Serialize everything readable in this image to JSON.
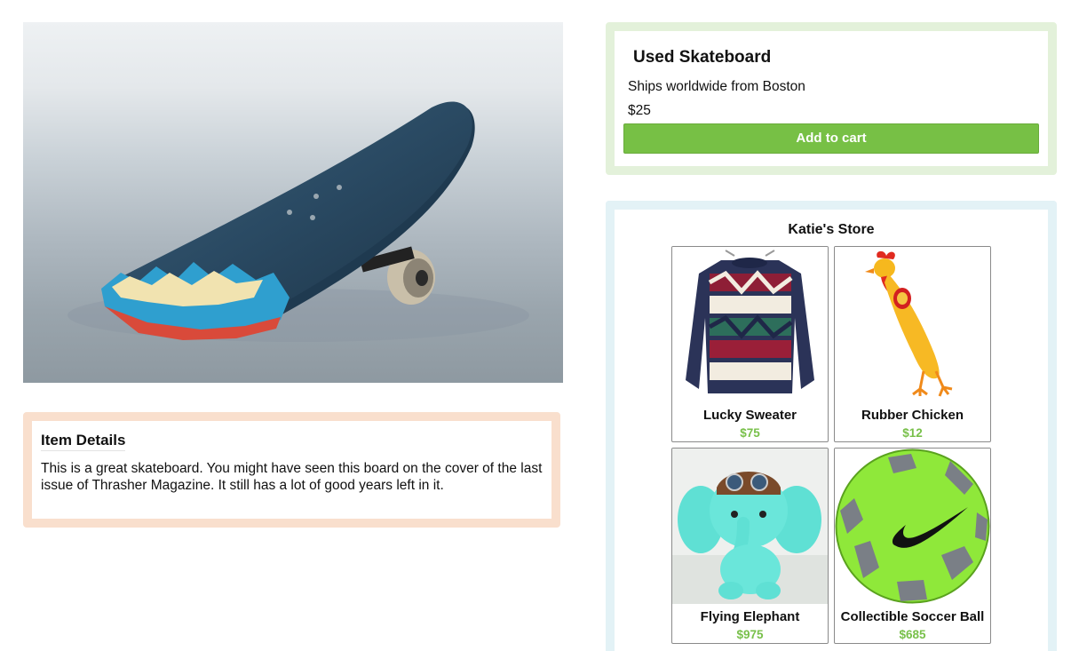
{
  "product": {
    "title": "Used Skateboard",
    "shipping": "Ships worldwide from Boston",
    "price": "$25",
    "add_to_cart_label": "Add to cart"
  },
  "details": {
    "heading": "Item Details",
    "description": "This is a great skateboard. You might have seen this board on the cover of the last issue of Thrasher Magazine. It still has a lot of good years left in it."
  },
  "store": {
    "name": "Katie's Store",
    "items": [
      {
        "name": "Lucky Sweater",
        "price": "$75",
        "image": "sweater-image"
      },
      {
        "name": "Rubber Chicken",
        "price": "$12",
        "image": "rubber-chicken-image"
      },
      {
        "name": "Flying Elephant",
        "price": "$975",
        "image": "plush-elephant-image"
      },
      {
        "name": "Collectible Soccer Ball",
        "price": "$685",
        "image": "soccer-ball-image"
      }
    ]
  },
  "colors": {
    "accent_green": "#77c045",
    "price_green": "#78c04a",
    "product_border": "#e3f1da",
    "details_border": "#f9dfcd",
    "store_border": "#e3f2f6"
  }
}
